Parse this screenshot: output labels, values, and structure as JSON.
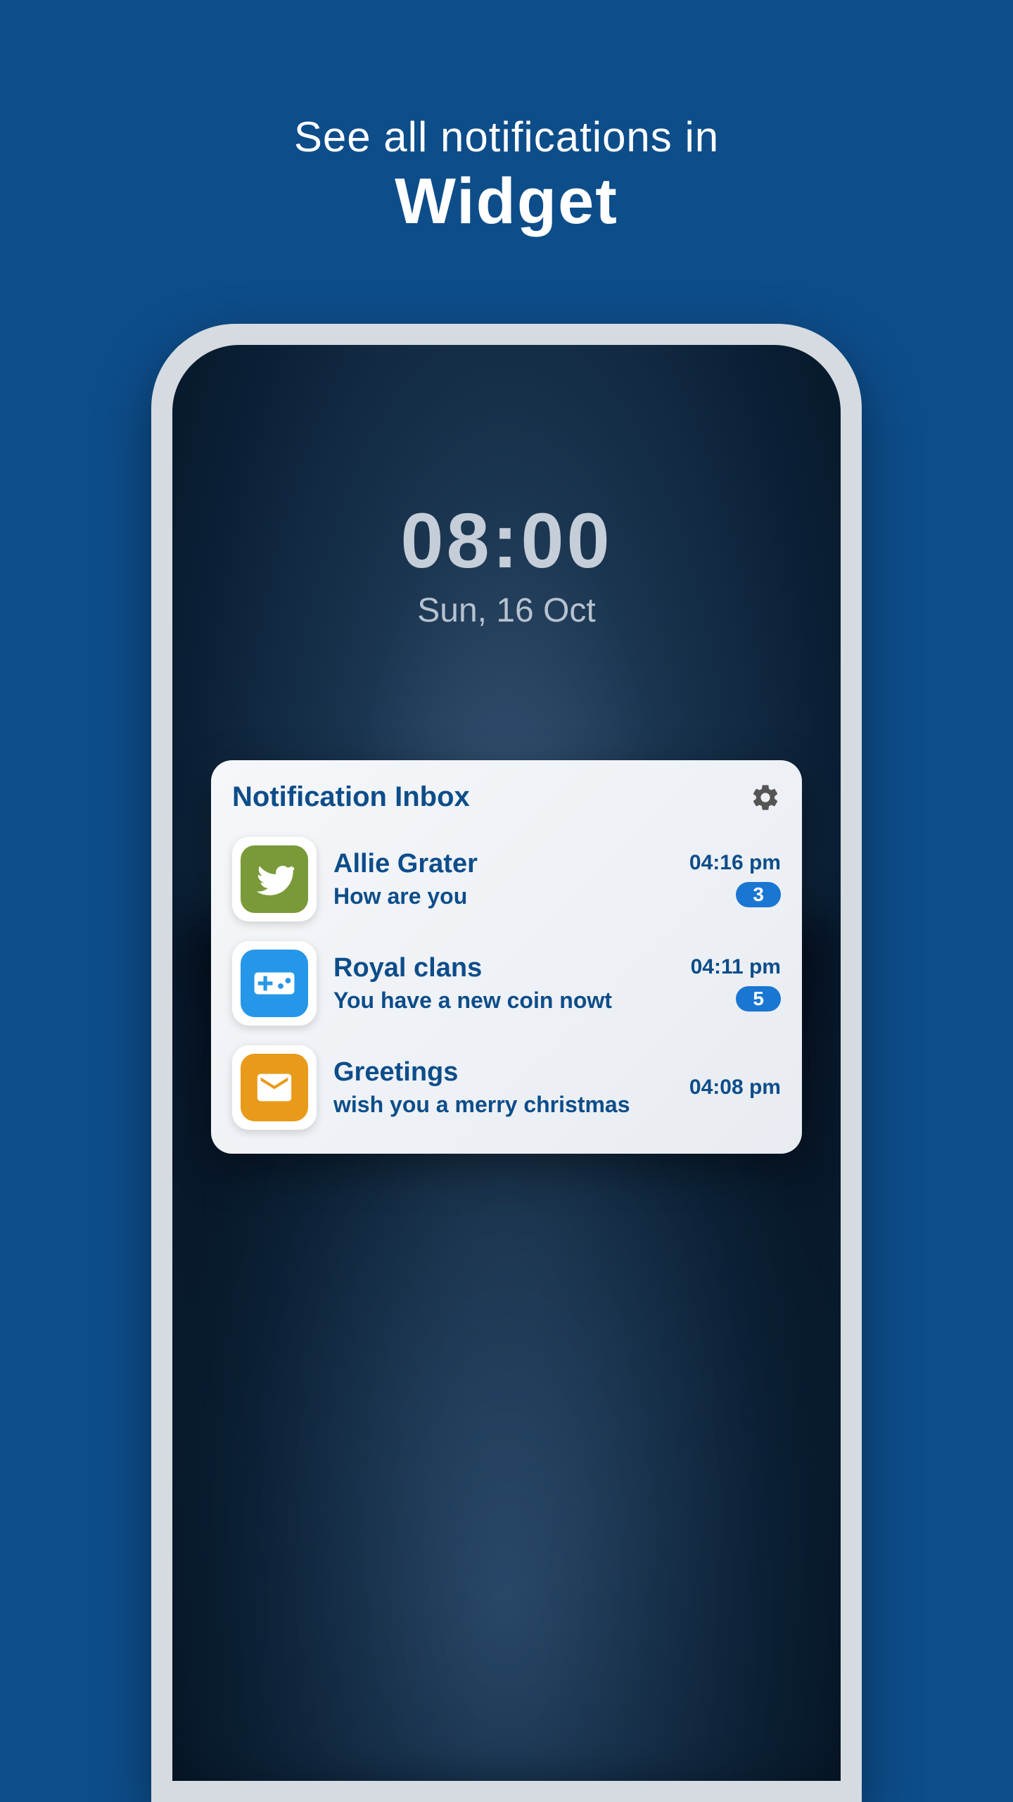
{
  "headline": {
    "top": "See all notifications in",
    "bottom": "Widget"
  },
  "clock": {
    "time": "08:00",
    "date": "Sun, 16 Oct"
  },
  "widget": {
    "title": "Notification Inbox",
    "items": [
      {
        "title": "Allie Grater",
        "message": "How are you",
        "time": "04:16 pm",
        "badge": "3",
        "icon": "bird"
      },
      {
        "title": "Royal clans",
        "message": "You have a new coin nowt",
        "time": "04:11 pm",
        "badge": "5",
        "icon": "gamepad"
      },
      {
        "title": "Greetings",
        "message": "wish you a merry christmas",
        "time": "04:08 pm",
        "badge": null,
        "icon": "mail"
      }
    ]
  }
}
